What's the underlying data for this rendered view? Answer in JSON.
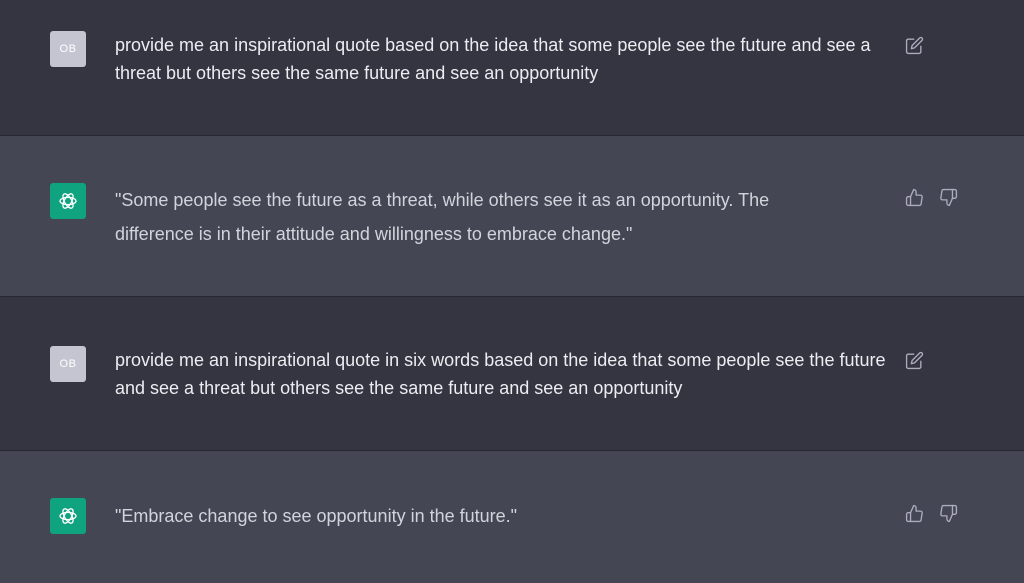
{
  "colors": {
    "user_bg": "#343541",
    "bot_bg": "#444654",
    "bot_avatar": "#10a37f",
    "user_avatar": "#c5c5d2",
    "text": "#ececf1",
    "icon": "#acacbe"
  },
  "messages": [
    {
      "role": "user",
      "avatar": "OB",
      "text": "provide me an inspirational quote based on the idea that some people see the future and see a threat but others see the same future and see an opportunity",
      "actions": [
        "edit-icon"
      ]
    },
    {
      "role": "assistant",
      "avatar_icon": "openai-logo-icon",
      "text": "\"Some people see the future as a threat, while others see it as an opportunity. The difference is in their attitude and willingness to embrace change.\"",
      "actions": [
        "thumbs-up-icon",
        "thumbs-down-icon"
      ]
    },
    {
      "role": "user",
      "avatar": "OB",
      "text": "provide me an inspirational quote in six words based on the idea that some people see the future and see a threat but others see the same future and see an opportunity",
      "actions": [
        "edit-icon"
      ]
    },
    {
      "role": "assistant",
      "avatar_icon": "openai-logo-icon",
      "text": "\"Embrace change to see opportunity in the future.\"",
      "actions": [
        "thumbs-up-icon",
        "thumbs-down-icon"
      ]
    }
  ]
}
